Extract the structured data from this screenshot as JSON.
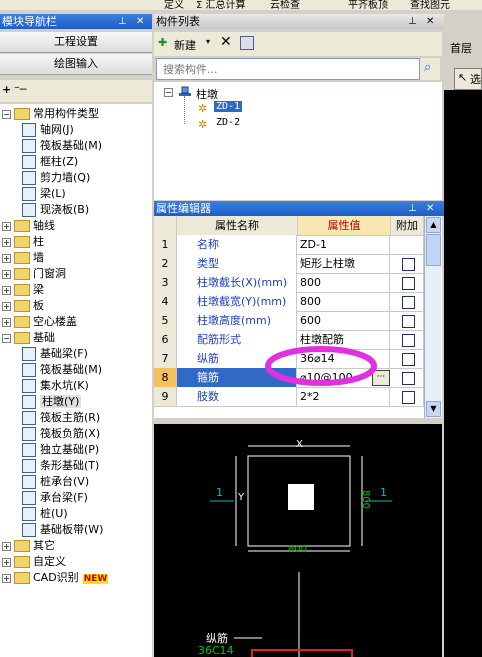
{
  "toolbar": {
    "items": [
      "定义",
      "Σ 汇总计算",
      "云检查",
      "平齐板顶",
      "查找图元"
    ]
  },
  "left_panel": {
    "title": "模块导航栏",
    "btn_project": "工程设置",
    "btn_drawing": "绘图输入",
    "tree": [
      {
        "label": "常用构件类型",
        "level": 0,
        "type": "folder",
        "expanded": true
      },
      {
        "label": "轴网(J)",
        "level": 1,
        "type": "item"
      },
      {
        "label": "筏板基础(M)",
        "level": 1,
        "type": "item"
      },
      {
        "label": "框柱(Z)",
        "level": 1,
        "type": "item"
      },
      {
        "label": "剪力墙(Q)",
        "level": 1,
        "type": "item"
      },
      {
        "label": "梁(L)",
        "level": 1,
        "type": "item"
      },
      {
        "label": "现浇板(B)",
        "level": 1,
        "type": "item"
      },
      {
        "label": "轴线",
        "level": 0,
        "type": "folder",
        "expanded": false
      },
      {
        "label": "柱",
        "level": 0,
        "type": "folder",
        "expanded": false
      },
      {
        "label": "墙",
        "level": 0,
        "type": "folder",
        "expanded": false
      },
      {
        "label": "门窗洞",
        "level": 0,
        "type": "folder",
        "expanded": false
      },
      {
        "label": "梁",
        "level": 0,
        "type": "folder",
        "expanded": false
      },
      {
        "label": "板",
        "level": 0,
        "type": "folder",
        "expanded": false
      },
      {
        "label": "空心楼盖",
        "level": 0,
        "type": "folder",
        "expanded": false
      },
      {
        "label": "基础",
        "level": 0,
        "type": "folder",
        "expanded": true
      },
      {
        "label": "基础梁(F)",
        "level": 1,
        "type": "item"
      },
      {
        "label": "筏板基础(M)",
        "level": 1,
        "type": "item"
      },
      {
        "label": "集水坑(K)",
        "level": 1,
        "type": "item"
      },
      {
        "label": "柱墩(Y)",
        "level": 1,
        "type": "item",
        "selected": true
      },
      {
        "label": "筏板主筋(R)",
        "level": 1,
        "type": "item"
      },
      {
        "label": "筏板负筋(X)",
        "level": 1,
        "type": "item"
      },
      {
        "label": "独立基础(P)",
        "level": 1,
        "type": "item"
      },
      {
        "label": "条形基础(T)",
        "level": 1,
        "type": "item"
      },
      {
        "label": "桩承台(V)",
        "level": 1,
        "type": "item"
      },
      {
        "label": "承台梁(F)",
        "level": 1,
        "type": "item"
      },
      {
        "label": "桩(U)",
        "level": 1,
        "type": "item"
      },
      {
        "label": "基础板带(W)",
        "level": 1,
        "type": "item"
      },
      {
        "label": "其它",
        "level": 0,
        "type": "folder",
        "expanded": false
      },
      {
        "label": "自定义",
        "level": 0,
        "type": "folder",
        "expanded": false
      },
      {
        "label": "CAD识别",
        "level": 0,
        "type": "folder",
        "expanded": false,
        "badge": "NEW"
      }
    ]
  },
  "component_list": {
    "title": "构件列表",
    "new_label": "新建",
    "search_placeholder": "搜索构件...",
    "root": "柱墩",
    "items": [
      "ZD-1",
      "ZD-2"
    ],
    "selected": "ZD-1"
  },
  "property_editor": {
    "title": "属性编辑器",
    "headers": [
      "属性名称",
      "属性值",
      "附加"
    ],
    "rows": [
      {
        "no": "1",
        "name": "名称",
        "value": "ZD-1",
        "check": false
      },
      {
        "no": "2",
        "name": "类型",
        "value": "矩形上柱墩",
        "check": true
      },
      {
        "no": "3",
        "name": "柱墩截长(X)(mm)",
        "value": "800",
        "check": true
      },
      {
        "no": "4",
        "name": "柱墩截宽(Y)(mm)",
        "value": "800",
        "check": true
      },
      {
        "no": "5",
        "name": "柱墩高度(mm)",
        "value": "600",
        "check": true
      },
      {
        "no": "6",
        "name": "配筋形式",
        "value": "柱墩配筋",
        "check": true
      },
      {
        "no": "7",
        "name": "纵筋",
        "value": "36⌀14",
        "check": true
      },
      {
        "no": "8",
        "name": "箍筋",
        "value": "⌀10@100",
        "check": true,
        "selected": true
      },
      {
        "no": "9",
        "name": "肢数",
        "value": "2*2",
        "check": true
      }
    ]
  },
  "cad_view": {
    "dim_x_top": "X",
    "dim_y_left": "Y",
    "dim_width": "800",
    "dim_height": "800",
    "section_mark": "1",
    "rebar_label": "纵筋",
    "rebar_value": "36C14"
  },
  "right_panel": {
    "floor_label": "首层",
    "select_label": "选"
  },
  "colors": {
    "title_blue": "#2a66d0",
    "selection_blue": "#3169c6",
    "cad_green": "#00c000",
    "highlight_magenta": "#e030e0"
  }
}
